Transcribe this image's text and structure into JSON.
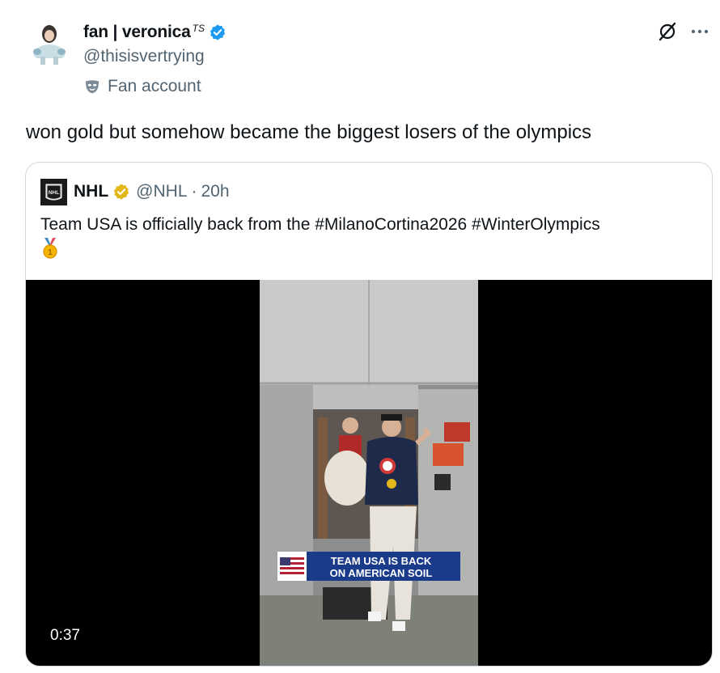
{
  "author": {
    "display_name": "fan | veronica",
    "name_suffix": "TS",
    "handle": "@thisisvertrying",
    "label": "Fan account",
    "avatar_icon": "avatar-image",
    "verified_icon": "verified-badge-icon"
  },
  "header_icons": [
    "grok-icon",
    "more-icon"
  ],
  "tweet": {
    "text": "won gold but somehow became the biggest losers of the olympics"
  },
  "quote": {
    "name": "NHL",
    "handle": "@NHL",
    "separator": "·",
    "time": "20h",
    "text": "Team USA is officially back from the #MilanoCortina2026 #WinterOlympics",
    "emoji_icon": "gold-medal-icon",
    "video": {
      "duration": "0:37",
      "banner_line1": "TEAM USA IS BACK",
      "banner_line2": "ON AMERICAN SOIL"
    }
  },
  "colors": {
    "text": "#0f1419",
    "secondary": "#536471",
    "verified_blue": "#1d9bf0",
    "verified_gold": "#e2b719",
    "border": "#cfd9de"
  }
}
